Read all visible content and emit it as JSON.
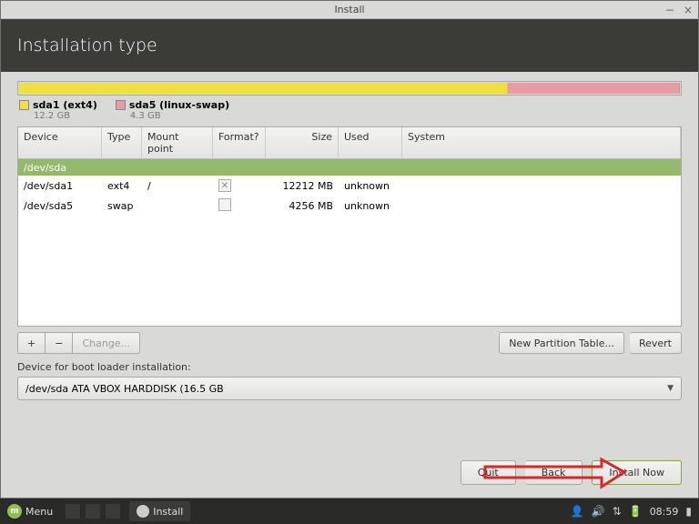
{
  "window": {
    "title": "Install"
  },
  "header": {
    "title": "Installation type"
  },
  "legend": {
    "partitions": [
      {
        "label": "sda1 (ext4)",
        "size": "12.2 GB",
        "color": "y"
      },
      {
        "label": "sda5 (linux-swap)",
        "size": "4.3 GB",
        "color": "p"
      }
    ]
  },
  "table": {
    "headers": {
      "device": "Device",
      "type": "Type",
      "mount": "Mount point",
      "format": "Format?",
      "size": "Size",
      "used": "Used",
      "system": "System"
    },
    "device_row": "/dev/sda",
    "rows": [
      {
        "device": "/dev/sda1",
        "type": "ext4",
        "mount": "/",
        "format": true,
        "size": "12212 MB",
        "used": "unknown"
      },
      {
        "device": "/dev/sda5",
        "type": "swap",
        "mount": "",
        "format": false,
        "size": "4256 MB",
        "used": "unknown"
      }
    ]
  },
  "toolbar": {
    "plus": "+",
    "minus": "−",
    "change": "Change...",
    "new_partition": "New Partition Table...",
    "revert": "Revert"
  },
  "boot": {
    "label": "Device for boot loader installation:",
    "value": "/dev/sda   ATA VBOX HARDDISK (16.5 GB"
  },
  "footer": {
    "quit": "Quit",
    "back": "Back",
    "install": "Install Now"
  },
  "taskbar": {
    "menu": "Menu",
    "task_label": "Install",
    "clock": "08:59"
  }
}
